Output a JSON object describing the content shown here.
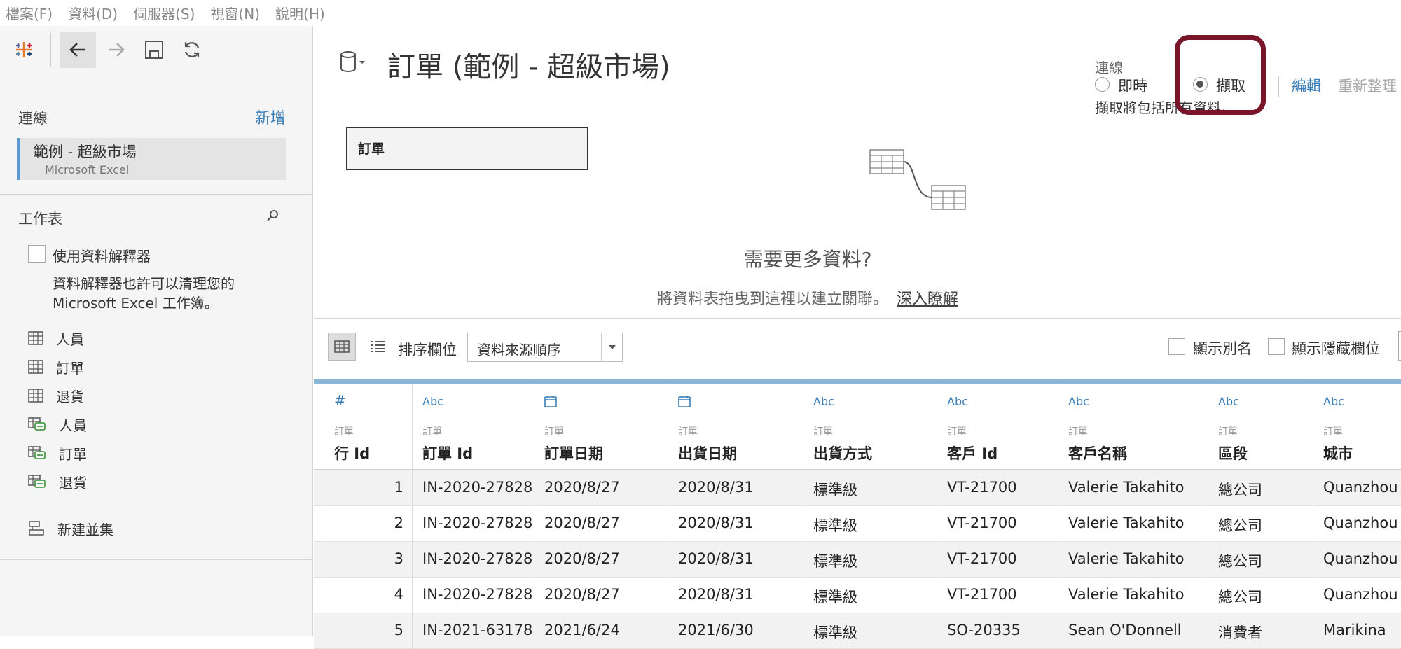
{
  "menu": [
    "檔案(F)",
    "資料(D)",
    "伺服器(S)",
    "視窗(N)",
    "說明(H)"
  ],
  "left": {
    "connections_label": "連線",
    "add_label": "新增",
    "connection": {
      "name": "範例 - 超級市場",
      "type": "Microsoft Excel"
    },
    "sheets_label": "工作表",
    "interpreter_label": "使用資料解釋器",
    "interpreter_desc": "資料解釋器也許可以清理您的 Microsoft Excel 工作簿。",
    "sheets": [
      {
        "label": "人員",
        "icon": "table-icon"
      },
      {
        "label": "訂單",
        "icon": "table-icon"
      },
      {
        "label": "退貨",
        "icon": "table-icon"
      },
      {
        "label": "人員",
        "icon": "named-range-icon"
      },
      {
        "label": "訂單",
        "icon": "named-range-icon"
      },
      {
        "label": "退貨",
        "icon": "named-range-icon"
      }
    ],
    "new_union": "新建並集"
  },
  "main": {
    "title": "訂單 (範例 - 超級市場)",
    "connection_label": "連線",
    "live_label": "即時",
    "extract_label": "擷取",
    "edit_label": "編輯",
    "refresh_label": "重新整理",
    "extract_note": "擷取將包括所有資料。",
    "canvas_table": "訂單",
    "need_more": "需要更多資料?",
    "drag_hint": "將資料表拖曳到這裡以建立關聯。",
    "learn_more": "深入瞭解",
    "sort_label": "排序欄位",
    "sort_value": "資料來源順序",
    "show_alias": "顯示別名",
    "show_hidden": "顯示隱藏欄位",
    "highlight_color": "#7a1428",
    "accent_color": "#3b7db8"
  },
  "table": {
    "columns": [
      {
        "type": "#",
        "source": "訂單",
        "name": "行 Id"
      },
      {
        "type": "Abc",
        "source": "訂單",
        "name": "訂單 Id"
      },
      {
        "type": "calendar-icon",
        "source": "訂單",
        "name": "訂單日期"
      },
      {
        "type": "calendar-icon",
        "source": "訂單",
        "name": "出貨日期"
      },
      {
        "type": "Abc",
        "source": "訂單",
        "name": "出貨方式"
      },
      {
        "type": "Abc",
        "source": "訂單",
        "name": "客戶 Id"
      },
      {
        "type": "Abc",
        "source": "訂單",
        "name": "客戶名稱"
      },
      {
        "type": "Abc",
        "source": "訂單",
        "name": "區段"
      },
      {
        "type": "Abc",
        "source": "訂單",
        "name": "城市"
      }
    ],
    "rows": [
      [
        "1",
        "IN-2020-27828",
        "2020/8/27",
        "2020/8/31",
        "標準級",
        "VT-21700",
        "Valerie Takahito",
        "總公司",
        "Quanzhou"
      ],
      [
        "2",
        "IN-2020-27828",
        "2020/8/27",
        "2020/8/31",
        "標準級",
        "VT-21700",
        "Valerie Takahito",
        "總公司",
        "Quanzhou"
      ],
      [
        "3",
        "IN-2020-27828",
        "2020/8/27",
        "2020/8/31",
        "標準級",
        "VT-21700",
        "Valerie Takahito",
        "總公司",
        "Quanzhou"
      ],
      [
        "4",
        "IN-2020-27828",
        "2020/8/27",
        "2020/8/31",
        "標準級",
        "VT-21700",
        "Valerie Takahito",
        "總公司",
        "Quanzhou"
      ],
      [
        "5",
        "IN-2021-63178",
        "2021/6/24",
        "2021/6/30",
        "標準級",
        "SO-20335",
        "Sean O'Donnell",
        "消費者",
        "Marikina"
      ]
    ]
  }
}
